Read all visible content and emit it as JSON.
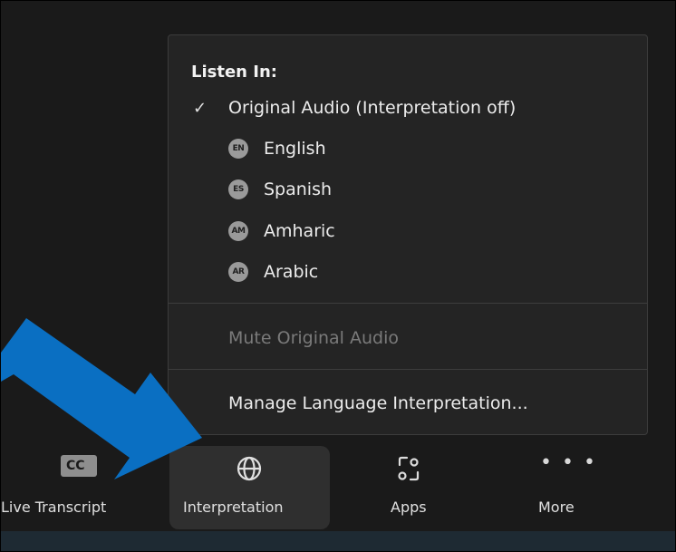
{
  "menu": {
    "heading": "Listen In:",
    "original_audio": {
      "label": "Original Audio (Interpretation off)",
      "checked": true,
      "check_glyph": "✓"
    },
    "languages": [
      {
        "badge": "EN",
        "label": "English"
      },
      {
        "badge": "ES",
        "label": "Spanish"
      },
      {
        "badge": "AM",
        "label": "Amharic"
      },
      {
        "badge": "AR",
        "label": "Arabic"
      }
    ],
    "mute_original": {
      "label": "Mute Original Audio",
      "enabled": false
    },
    "manage": {
      "label": "Manage Language Interpretation..."
    }
  },
  "toolbar": {
    "live_transcript": {
      "label": "Live Transcript",
      "icon_text": "CC",
      "icon": "closed-captions-icon"
    },
    "interpretation": {
      "label": "Interpretation",
      "icon": "globe-icon",
      "active": true
    },
    "apps": {
      "label": "Apps",
      "icon": "apps-icon"
    },
    "more": {
      "label": "More",
      "icon": "more-dots-icon",
      "icon_text": "• • •"
    }
  },
  "colors": {
    "background": "#1a1a1a",
    "menu_bg": "#242424",
    "callout_arrow": "#0a6fc2",
    "bottom_strip": "#1e2a33"
  }
}
